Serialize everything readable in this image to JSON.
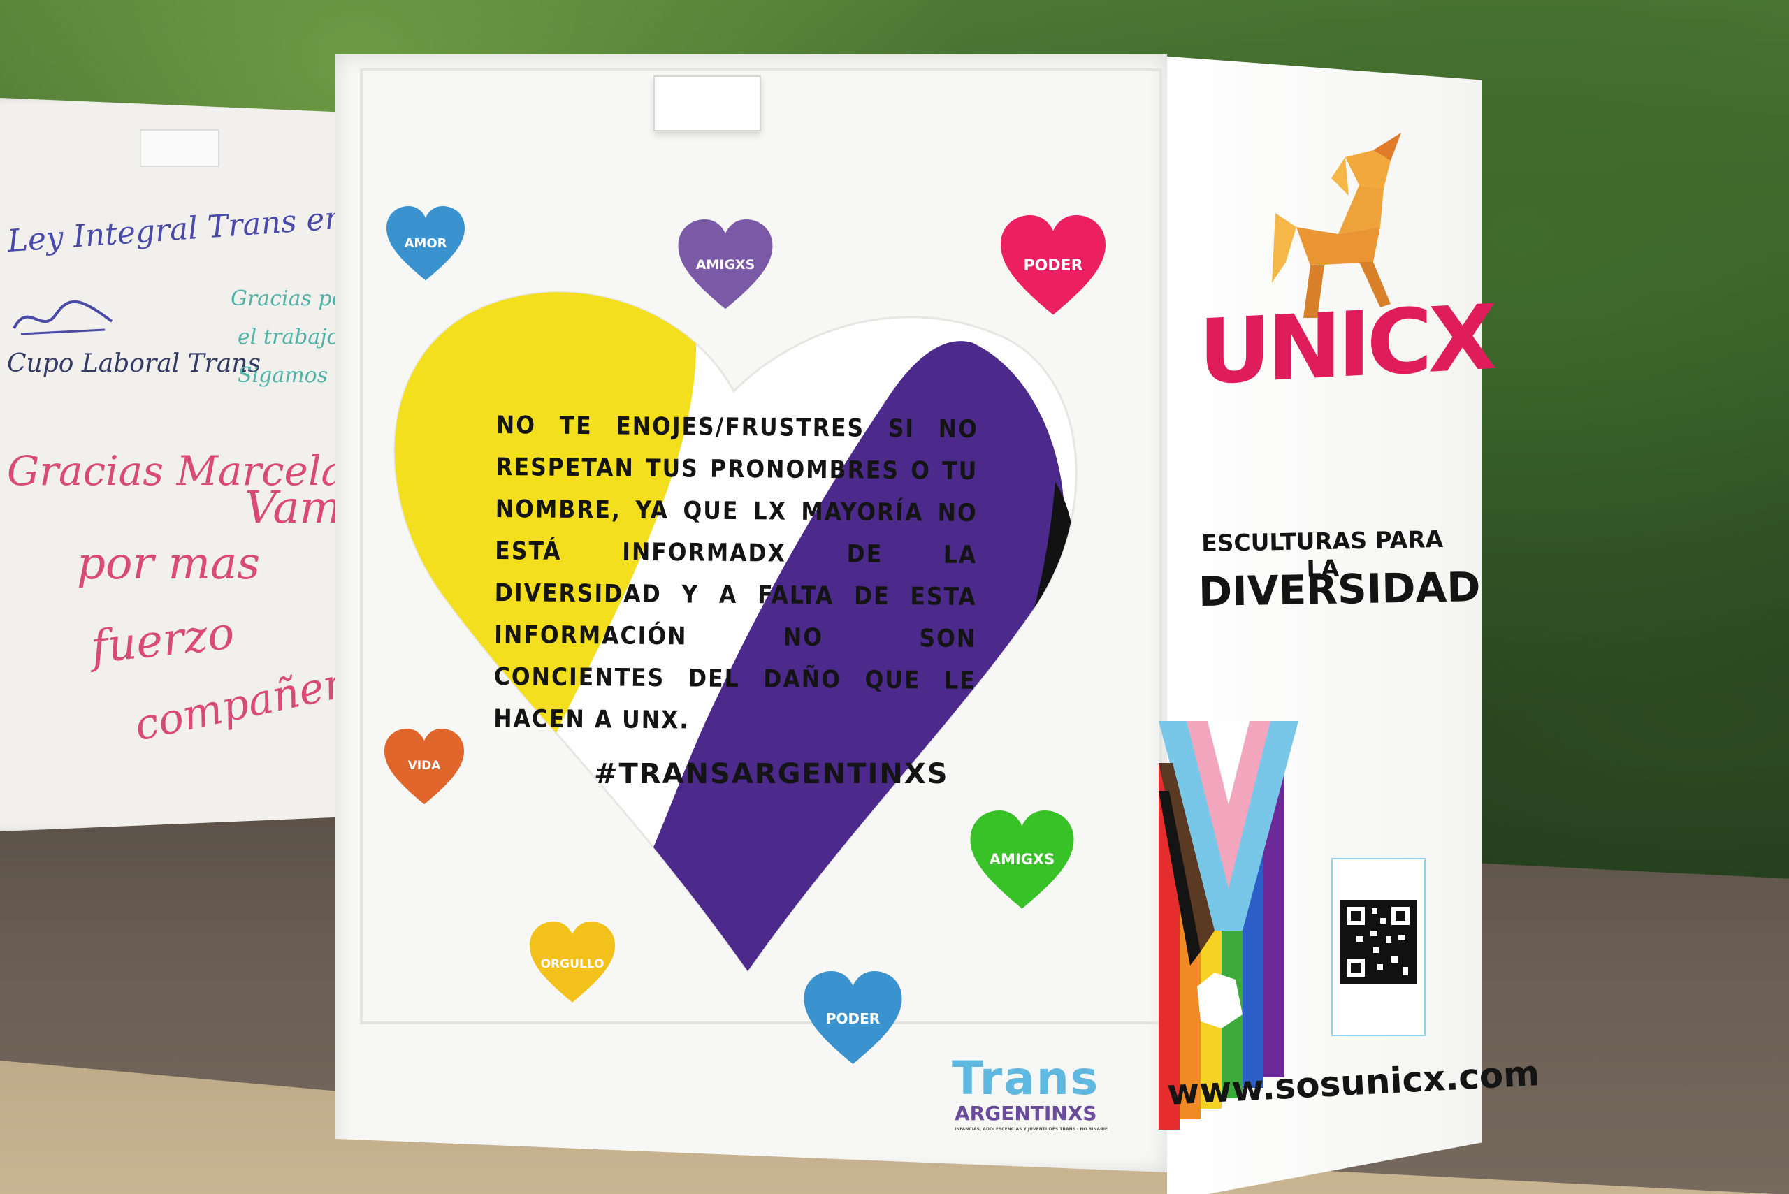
{
  "board": {
    "lines": [
      "Ley Integral Trans en Arg",
      "Cupo Laboral Trans",
      "Gracias po",
      "el trabajo",
      "Sigamos",
      "Gracias Marcela",
      "Vamo",
      "por mas",
      "fuerzo",
      "compañero"
    ]
  },
  "hearts": [
    {
      "label": "AMOR",
      "color": "#3a93cf"
    },
    {
      "label": "AMIGXS",
      "color": "#7a5aa6"
    },
    {
      "label": "PODER",
      "color": "#ec1f63"
    },
    {
      "label": "VIDA",
      "color": "#e0662b"
    },
    {
      "label": "AMIGXS",
      "color": "#39c228"
    },
    {
      "label": "ORGULLO",
      "color": "#f2c11c"
    },
    {
      "label": "PODER",
      "color": "#3a93cf"
    }
  ],
  "message": "NO TE ENOJES/FRUSTRES SI NO RESPETAN TUS PRONOMBRES O TU NOMBRE, YA QUE LX MAYORÍA NO ESTÁ INFORMADX DE LA DIVERSIDAD Y A FALTA DE ESTA INFORMACIÓN NO SON CONCIENTES DEL DAÑO QUE LE HACEN A UNX.",
  "hashtag": "#TRANSARGENTINXS",
  "trans_logo": {
    "word": "Trans",
    "sub": "ARGENTINXS",
    "tagline": "INFANCIAS, ADOLESCENCIAS Y JUVENTUDES TRANS · NO BINARIE"
  },
  "side": {
    "brand": "UNICX",
    "line1": "ESCULTURAS PARA LA",
    "line2": "DIVERSIDAD",
    "website": "www.sosunicx.com"
  },
  "colors": {
    "yellow": "#f3df1e",
    "purple": "#4b2a8c",
    "black": "#121212",
    "brand_pink": "#e01d5c",
    "unicorn_orange": "#eda23a"
  }
}
